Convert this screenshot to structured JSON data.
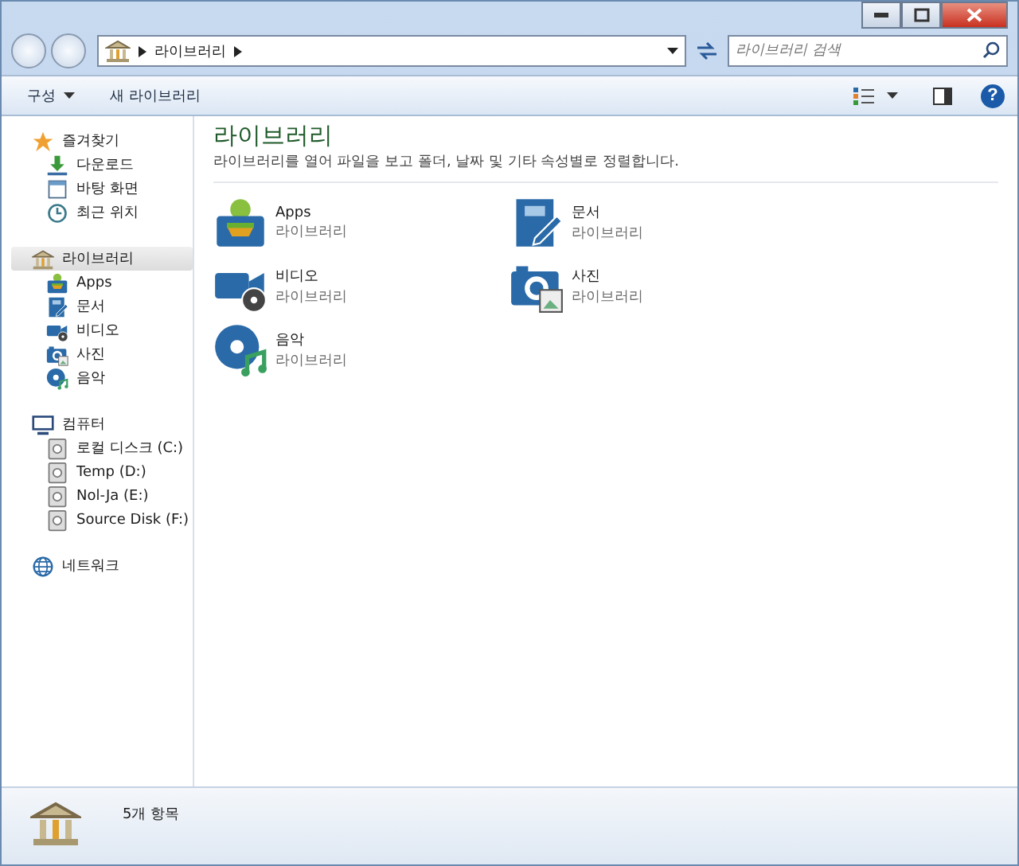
{
  "address_bar": {
    "path": [
      "라이브러리"
    ]
  },
  "search": {
    "placeholder": "라이브러리 검색"
  },
  "toolbar": {
    "buttons": [
      {
        "label": "구성",
        "dropdown": true
      },
      {
        "label": "새 라이브러리",
        "dropdown": false
      }
    ],
    "help": "?"
  },
  "sidebar": {
    "groups": [
      {
        "label": "즐겨찾기",
        "selected": false,
        "children": [
          {
            "label": "다운로드"
          },
          {
            "label": "바탕 화면"
          },
          {
            "label": "최근 위치"
          }
        ]
      },
      {
        "label": "라이브러리",
        "selected": true,
        "children": [
          {
            "label": "Apps"
          },
          {
            "label": "문서"
          },
          {
            "label": "비디오"
          },
          {
            "label": "사진"
          },
          {
            "label": "음악"
          }
        ]
      },
      {
        "label": "컴퓨터",
        "selected": false,
        "children": [
          {
            "label": "로컬 디스크 (C:)"
          },
          {
            "label": "Temp (D:)"
          },
          {
            "label": "Nol-Ja (E:)"
          },
          {
            "label": "Source Disk (F:)"
          }
        ]
      },
      {
        "label": "네트워크",
        "selected": false
      }
    ]
  },
  "content": {
    "title": "라이브러리",
    "description": "라이브러리를 열어 파일을 보고 폴더, 날짜 및 기타 속성별로 정렬합니다.",
    "items": [
      {
        "name": "Apps",
        "type": "라이브러리"
      },
      {
        "name": "문서",
        "type": "라이브러리"
      },
      {
        "name": "비디오",
        "type": "라이브러리"
      },
      {
        "name": "사진",
        "type": "라이브러리"
      },
      {
        "name": "음악",
        "type": "라이브러리"
      }
    ]
  },
  "status_bar": {
    "text": "5개 항목"
  }
}
